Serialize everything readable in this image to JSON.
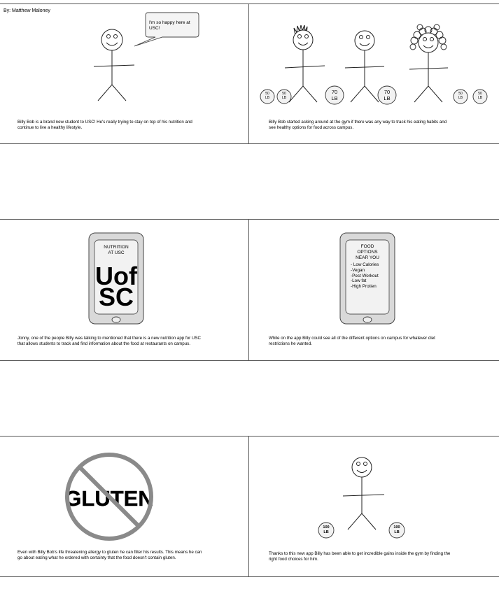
{
  "author": "By: Matthew Maloney",
  "panels": {
    "p1": {
      "speech": "I'm so happy here at\nUSC!",
      "caption": "Billy Bob is a brand new student to USC! He's really trying to stay on top of his nutrition and\ncontinue to live a healthy lifestyle."
    },
    "p2": {
      "weights": [
        "50\nLB",
        "50\nLB",
        "70\nLB",
        "70\nLB",
        "50\nLB",
        "50\nLB"
      ],
      "caption": "Billy Bob started asking around at the gym if there was any way to track his eating habits and\nsee healthy options for food across campus."
    },
    "p3": {
      "phone_title": "NUTRITION\nAT USC",
      "logo_line1": "Uof",
      "logo_line2": "SC",
      "caption": "Jonny, one of the people Billy was talking to mentioned that there is a new nutrition app for USC\nthat allows students to track and find information about the food at restaurants on campus."
    },
    "p4": {
      "phone_title": "FOOD\nOPTIONS\nNEAR YOU",
      "options": "- Low Calories\n-Vegan\n-Post Workout\n-Low fat\n-High Protien",
      "caption": "While on the app Billy could see all of the different options on campus for whatever diet\nrestrictions he wanted."
    },
    "p5": {
      "sign_text": "GLUTEN",
      "caption": "Even with Billy Bob's life threatening allergy to gluten he can filter his results. This means he can\ngo about eating what he ordered with certainty that the food doesn't contain gluten."
    },
    "p6": {
      "weight_left": "100\nLB",
      "weight_right": "100\nLB",
      "caption": "Thanks to this new app Billy has been able to get incredible gains inside the gym by finding the\nright food choices for him."
    }
  }
}
